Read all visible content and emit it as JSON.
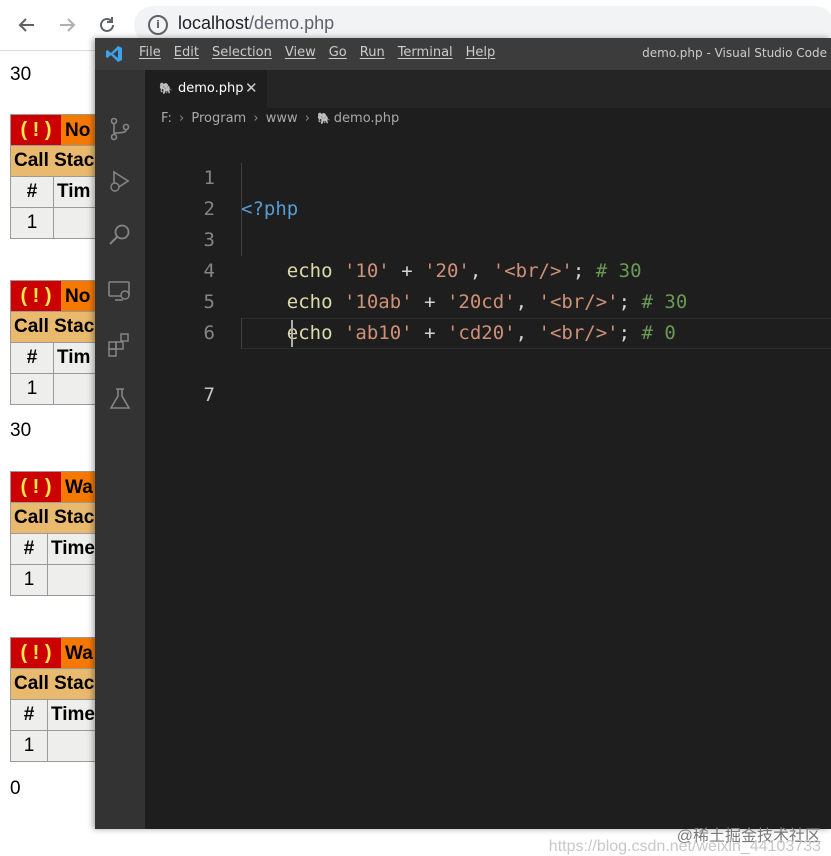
{
  "browser": {
    "url_host": "localhost",
    "url_path": "/demo.php",
    "back_icon": "arrow-left-icon",
    "forward_icon": "arrow-right-icon",
    "reload_icon": "reload-icon",
    "info_icon": "info-icon",
    "info_glyph": "i"
  },
  "page": {
    "outputs": [
      "30",
      "30",
      "0"
    ],
    "error_blocks": [
      {
        "bang": "( ! )",
        "title_partial": "No",
        "stack_partial": "Call Stac",
        "col_num": "#",
        "col_time_partial": "Tim",
        "row_num": "1"
      },
      {
        "bang": "( ! )",
        "title_partial": "No",
        "stack_partial": "Call Stac",
        "col_num": "#",
        "col_time_partial": "Tim",
        "row_num": "1"
      },
      {
        "bang": "( ! )",
        "title_partial": "Wa",
        "stack_partial": "Call Stac",
        "col_num": "#",
        "col_time_partial": "Time",
        "row_num": "1"
      },
      {
        "bang": "( ! )",
        "title_partial": "Wa",
        "stack_partial": "Call Stac",
        "col_num": "#",
        "col_time_partial": "Time",
        "row_num": "1"
      }
    ]
  },
  "vscode": {
    "window_title": "demo.php - Visual Studio Code",
    "menu": [
      "File",
      "Edit",
      "Selection",
      "View",
      "Go",
      "Run",
      "Terminal",
      "Help"
    ],
    "tab": {
      "label": "demo.php",
      "close": "✕",
      "icon": "php-elephant-icon",
      "icon_glyph": "🐘"
    },
    "breadcrumb": {
      "items": [
        "F:",
        "Program",
        "www",
        "demo.php"
      ],
      "sep": "›"
    },
    "activity_icons": [
      "source-control-icon",
      "run-debug-icon",
      "search-icon",
      "remote-explorer-icon",
      "extensions-icon",
      "testing-icon"
    ],
    "line_numbers": [
      "1",
      "2",
      "3",
      "4",
      "5",
      "6",
      "7"
    ],
    "code": {
      "l1": {
        "tag": "<?php"
      },
      "l2": {
        "kw": "echo",
        "s1": "'10'",
        "op": "+",
        "s2": "'20'",
        "comma1": ",",
        "s3": "'<br/>'",
        "semi": ";",
        "comment": "# 30"
      },
      "l3": {
        "kw": "echo",
        "s1": "'10ab'",
        "op": "+",
        "s2": "'20cd'",
        "comma1": ",",
        "s3": "'<br/>'",
        "semi": ";",
        "comment": "# 30"
      },
      "l4": {
        "kw": "echo",
        "s1": "'ab10'",
        "op": "+",
        "s2": "'cd20'",
        "comma1": ",",
        "s3": "'<br/>'",
        "semi": ";",
        "comment": "# 0"
      }
    }
  },
  "watermark": {
    "line1": "@稀土掘金技术社区",
    "line2": "https://blog.csdn.net/weixin_44103733"
  }
}
